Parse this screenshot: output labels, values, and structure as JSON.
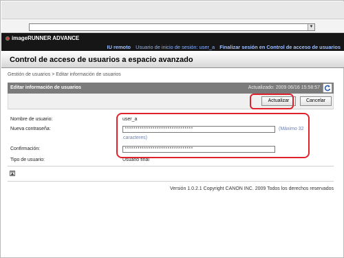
{
  "header": {
    "brand": "imageRUNNER ADVANCE",
    "nav": {
      "remote_ui": "IU remoto",
      "login_user": "Usuario de inicio de sesión: user_a",
      "logout": "Finalizar sesión en Control de acceso de usuarios"
    }
  },
  "page": {
    "title": "Control de acceso de usuarios a espacio avanzado",
    "breadcrumb": "Gestión de usuarios > Editar información de usuarios"
  },
  "section": {
    "title": "Editar información de usuarios",
    "updated": "Actualizado: 2009 06/16 15:58:57"
  },
  "buttons": {
    "update": "Actualizar",
    "cancel": "Cancelar"
  },
  "form": {
    "username_label": "Nombre de usuario:",
    "username_value": "user_a",
    "new_password_label": "Nueva contraseña:",
    "new_password_value": "********************************",
    "max_hint_1": "(Máximo 32",
    "max_hint_2": "caracteres)",
    "confirm_label": "Confirmación:",
    "confirm_value": "********************************",
    "user_type_label": "Tipo de usuario:",
    "user_type_value": "Usuario final"
  },
  "footer": {
    "copyright": "Versión 1.0.2.1 Copyright CANON INC. 2009 Todos los derechos reservados"
  },
  "colors": {
    "header_bg": "#161616",
    "header_link": "#8fb4ff",
    "section_bar": "#7b7b7b",
    "highlight": "#e0202a",
    "hint": "#6b7fb3"
  }
}
